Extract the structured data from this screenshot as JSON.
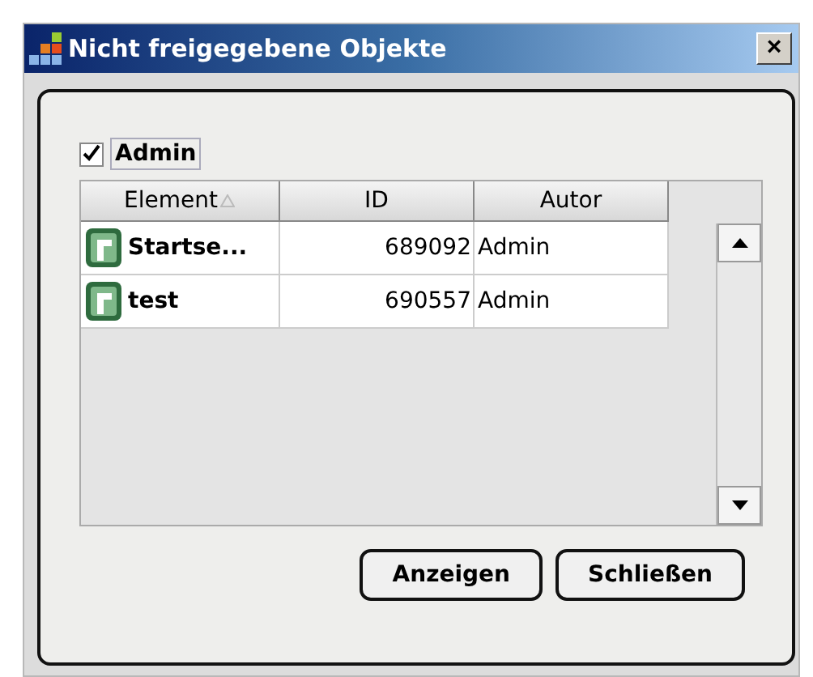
{
  "window": {
    "title": "Nicht freigegebene Objekte",
    "close": "×"
  },
  "filter": {
    "label": "Admin",
    "checked": true
  },
  "table": {
    "columns": [
      {
        "label": "Element",
        "sorted": true
      },
      {
        "label": "ID",
        "sorted": false
      },
      {
        "label": "Autor",
        "sorted": false
      }
    ],
    "rows": [
      {
        "element": "Startse...",
        "id": "689092",
        "autor": "Admin"
      },
      {
        "element": "test",
        "id": "690557",
        "autor": "Admin"
      }
    ]
  },
  "buttons": [
    "Anzeigen",
    "Schließen"
  ]
}
